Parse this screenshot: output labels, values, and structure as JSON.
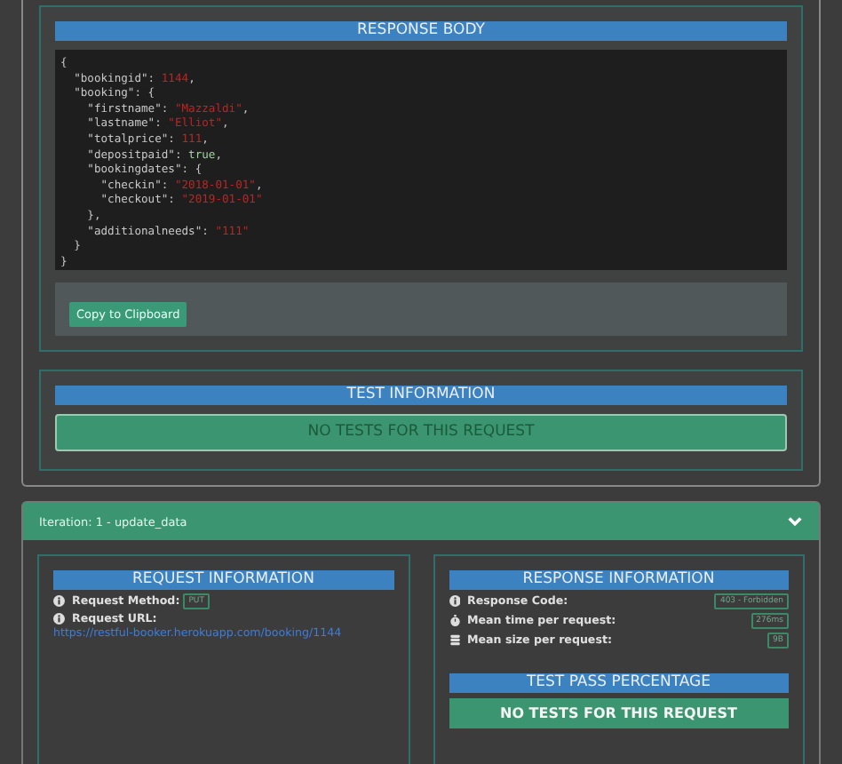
{
  "response_body": {
    "title": "RESPONSE BODY",
    "lines": [
      [
        {
          "text": "{",
          "kind": "punct"
        }
      ],
      [
        {
          "text": "  \"bookingid\"",
          "kind": "key"
        },
        {
          "text": ": ",
          "kind": "punct"
        },
        {
          "text": "1144",
          "kind": "number"
        },
        {
          "text": ",",
          "kind": "punct"
        }
      ],
      [
        {
          "text": "  \"booking\"",
          "kind": "key"
        },
        {
          "text": ": {",
          "kind": "punct"
        }
      ],
      [
        {
          "text": "    \"firstname\"",
          "kind": "key"
        },
        {
          "text": ": ",
          "kind": "punct"
        },
        {
          "text": "\"Mazzaldi\"",
          "kind": "string"
        },
        {
          "text": ",",
          "kind": "punct"
        }
      ],
      [
        {
          "text": "    \"lastname\"",
          "kind": "key"
        },
        {
          "text": ": ",
          "kind": "punct"
        },
        {
          "text": "\"Elliot\"",
          "kind": "string"
        },
        {
          "text": ",",
          "kind": "punct"
        }
      ],
      [
        {
          "text": "    \"totalprice\"",
          "kind": "key"
        },
        {
          "text": ": ",
          "kind": "punct"
        },
        {
          "text": "111",
          "kind": "number"
        },
        {
          "text": ",",
          "kind": "punct"
        }
      ],
      [
        {
          "text": "    \"depositpaid\"",
          "kind": "key"
        },
        {
          "text": ": ",
          "kind": "punct"
        },
        {
          "text": "true",
          "kind": "bool"
        },
        {
          "text": ",",
          "kind": "punct"
        }
      ],
      [
        {
          "text": "    \"bookingdates\"",
          "kind": "key"
        },
        {
          "text": ": {",
          "kind": "punct"
        }
      ],
      [
        {
          "text": "      \"checkin\"",
          "kind": "key"
        },
        {
          "text": ": ",
          "kind": "punct"
        },
        {
          "text": "\"2018-01-01\"",
          "kind": "string"
        },
        {
          "text": ",",
          "kind": "punct"
        }
      ],
      [
        {
          "text": "      \"checkout\"",
          "kind": "key"
        },
        {
          "text": ": ",
          "kind": "punct"
        },
        {
          "text": "\"2019-01-01\"",
          "kind": "string"
        }
      ],
      [
        {
          "text": "    },",
          "kind": "punct"
        }
      ],
      [
        {
          "text": "    \"additionalneeds\"",
          "kind": "key"
        },
        {
          "text": ": ",
          "kind": "punct"
        },
        {
          "text": "\"111\"",
          "kind": "string"
        }
      ],
      [
        {
          "text": "  }",
          "kind": "punct"
        }
      ],
      [
        {
          "text": "}",
          "kind": "punct"
        }
      ]
    ],
    "copy_button": "Copy to Clipboard"
  },
  "test_information": {
    "title": "TEST INFORMATION",
    "message": "NO TESTS FOR THIS REQUEST"
  },
  "iteration": {
    "title": "Iteration: 1 - update_data",
    "expanded": true,
    "request_information": {
      "title": "REQUEST INFORMATION",
      "method_label": "Request Method:",
      "method": "PUT",
      "url_label": "Request URL:",
      "url": "https://restful-booker.herokuapp.com/booking/1144"
    },
    "response_information": {
      "title": "RESPONSE INFORMATION",
      "rows": [
        {
          "kind": "info",
          "label": "Response Code:",
          "value": "403 - Forbidden"
        },
        {
          "kind": "stopwatch",
          "label": "Mean time per request:",
          "value": "276ms"
        },
        {
          "kind": "database",
          "label": "Mean size per request:",
          "value": "9B"
        }
      ]
    },
    "test_pass": {
      "title": "TEST PASS PERCENTAGE",
      "message": "NO TESTS FOR THIS REQUEST"
    }
  }
}
